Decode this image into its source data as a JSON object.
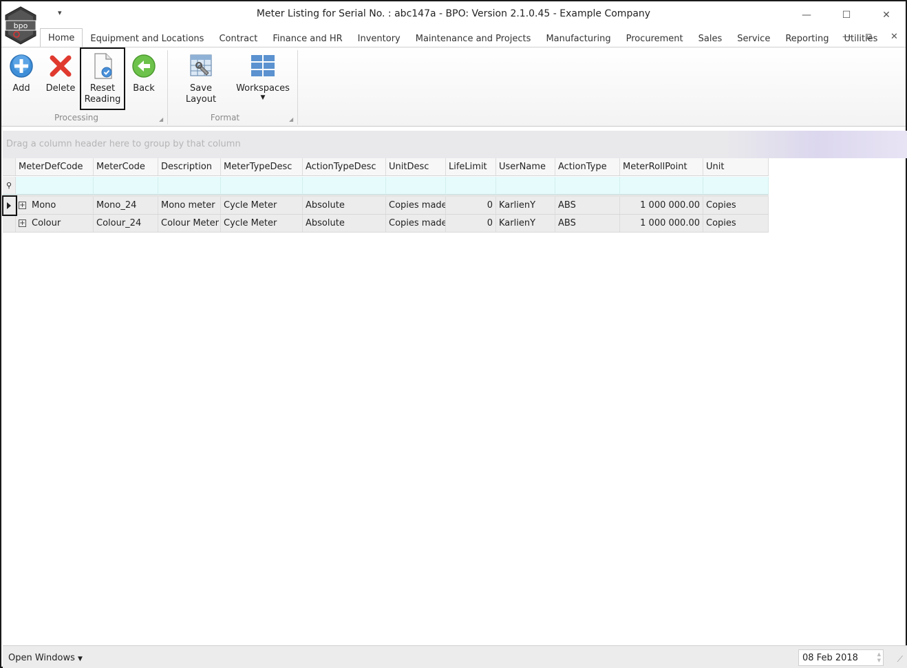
{
  "window": {
    "title": "Meter Listing for Serial No. : abc147a - BPO: Version 2.1.0.45 - Example Company",
    "logo_text": "bpo",
    "qat_glyph": "▾",
    "minimize_glyph": "—",
    "maximize_glyph": "☐",
    "close_glyph": "✕"
  },
  "tabs": [
    "Home",
    "Equipment and Locations",
    "Contract",
    "Finance and HR",
    "Inventory",
    "Maintenance and Projects",
    "Manufacturing",
    "Procurement",
    "Sales",
    "Service",
    "Reporting",
    "Utilities"
  ],
  "mdi": {
    "minimize": "—",
    "restore": "⧉",
    "close": "✕"
  },
  "ribbon": {
    "processing": {
      "label": "Processing",
      "add": "Add",
      "delete": "Delete",
      "reset_line1": "Reset",
      "reset_line2": "Reading",
      "back": "Back"
    },
    "format": {
      "label": "Format",
      "save_layout": "Save Layout",
      "workspaces": "Workspaces"
    }
  },
  "grid": {
    "group_panel_text": "Drag a column header here to group by that column",
    "columns": [
      "MeterDefCode",
      "MeterCode",
      "Description",
      "MeterTypeDesc",
      "ActionTypeDesc",
      "UnitDesc",
      "LifeLimit",
      "UserName",
      "ActionType",
      "MeterRollPoint",
      "Unit"
    ],
    "rows": [
      [
        "Mono",
        "Mono_24",
        "Mono meter",
        "Cycle Meter",
        "Absolute",
        "Copies made",
        "0",
        "KarlienY",
        "ABS",
        "1 000 000.00",
        "Copies"
      ],
      [
        "Colour",
        "Colour_24",
        "Colour Meter",
        "Cycle Meter",
        "Absolute",
        "Copies made",
        "0",
        "KarlienY",
        "ABS",
        "1 000 000.00",
        "Copies"
      ]
    ],
    "current_row": 0
  },
  "statusbar": {
    "open_windows": "Open Windows",
    "date": "08 Feb 2018"
  }
}
